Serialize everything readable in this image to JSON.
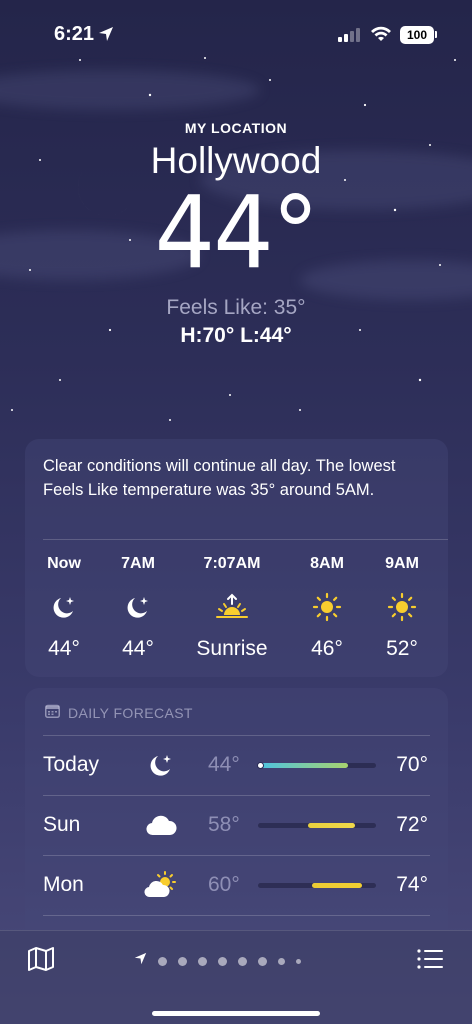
{
  "status_bar": {
    "time": "6:21",
    "battery": "100"
  },
  "header": {
    "label": "MY LOCATION",
    "city": "Hollywood",
    "temperature": "44°",
    "feels_like": "Feels Like: 35°",
    "high_low": "H:70°  L:44°"
  },
  "hourly": {
    "summary": "Clear conditions will continue all day. The lowest Feels Like temperature was 35° around 5AM.",
    "items": [
      {
        "time": "Now",
        "icon": "moon-stars-icon",
        "temp": "44°"
      },
      {
        "time": "7AM",
        "icon": "moon-stars-icon",
        "temp": "44°"
      },
      {
        "time": "7:07AM",
        "icon": "sunrise-icon",
        "temp": "Sunrise"
      },
      {
        "time": "8AM",
        "icon": "sun-icon",
        "temp": "46°"
      },
      {
        "time": "9AM",
        "icon": "sun-icon",
        "temp": "52°"
      }
    ]
  },
  "daily": {
    "header": "DAILY FORECAST",
    "days": [
      {
        "name": "Today",
        "icon": "moon-stars-icon",
        "low": "44°",
        "high": "70°",
        "range_start": 0.02,
        "range_end": 0.76,
        "current": 0.02,
        "gradient": [
          "#4ec4e0",
          "#a8d26e"
        ]
      },
      {
        "name": "Sun",
        "icon": "cloud-icon",
        "low": "58°",
        "high": "72°",
        "range_start": 0.42,
        "range_end": 0.82,
        "gradient": [
          "#e8cf3e",
          "#f0d94a"
        ]
      },
      {
        "name": "Mon",
        "icon": "partly-sunny-icon",
        "low": "60°",
        "high": "74°",
        "range_start": 0.46,
        "range_end": 0.88,
        "gradient": [
          "#eccb35",
          "#f2cf32"
        ]
      }
    ]
  },
  "colors": {
    "background_top": "#24254a",
    "background_bottom": "#4a4a7a",
    "sun": "#f8cd2e"
  },
  "bottom_bar": {
    "page_count": 9
  }
}
